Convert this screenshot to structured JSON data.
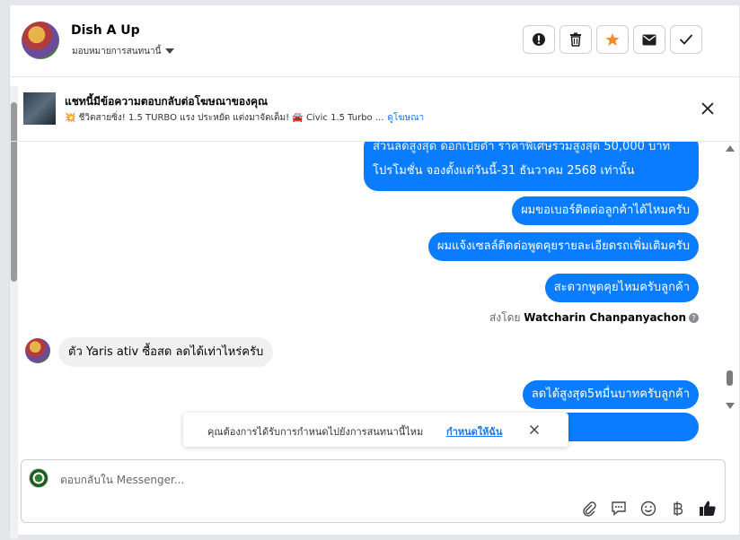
{
  "header": {
    "name": "Dish A Up",
    "assign_label": "มอบหมายการสนทนานี้",
    "tools": [
      {
        "icon": "alert-icon"
      },
      {
        "icon": "trash-icon"
      },
      {
        "icon": "star-icon"
      },
      {
        "icon": "mail-icon"
      },
      {
        "icon": "check-icon"
      }
    ]
  },
  "ad": {
    "title": "แชทนี้มีข้อความตอบกลับต่อโฆษณาของคุณ",
    "subtitle": "💥 ชีวิตสายซิ่ง! 1.5 TURBO แรง ประหยัด แต่งมาจัดเต็ม! 🚘 Civic 1.5 Turbo ...",
    "link": "ดูโฆษณา"
  },
  "messages": {
    "big_line1": "ส่วนลดสูงสุด ดอกเบี้ยต่ำ ราคาพิเศษรวมสูงสุด 50,000 บาท",
    "big_line2": "โปรโมชั่น  จองตั้งแต่วันนี้-31 ธันวาคม 2568 เท่านั้น",
    "out1": "ผมขอเบอร์ติดต่อลูกค้าได้ไหมครับ",
    "out2": "ผมแจ้งเซลล์ติดต่อพูดคุยรายละเอียดรถเพิ่มเติมครับ",
    "out3": "สะดวกพูดคุยไหมครับลูกค้า",
    "sent_by_prefix": "ส่งโดย",
    "sent_by_name": "Watcharin Chanpanyachon",
    "incoming": "ตัว Yaris ativ ซื้อสด ลดได้เท่าไหร่ครับ",
    "out4": "ลดได้สูงสุด5หมื่นบาทครับลูกค้า"
  },
  "toast": {
    "message": "คุณต้องการได้รับการกำหนดไปยังการสนทนานี้ไหม",
    "action": "กำหนดให้ฉัน"
  },
  "composer": {
    "placeholder": "ตอบกลับใน Messenger...",
    "icons": [
      "attach-icon",
      "quick-reply-icon",
      "emoji-icon",
      "baht-icon",
      "like-icon"
    ]
  },
  "colors": {
    "accent": "#0a7cff",
    "star": "#f28c28"
  }
}
